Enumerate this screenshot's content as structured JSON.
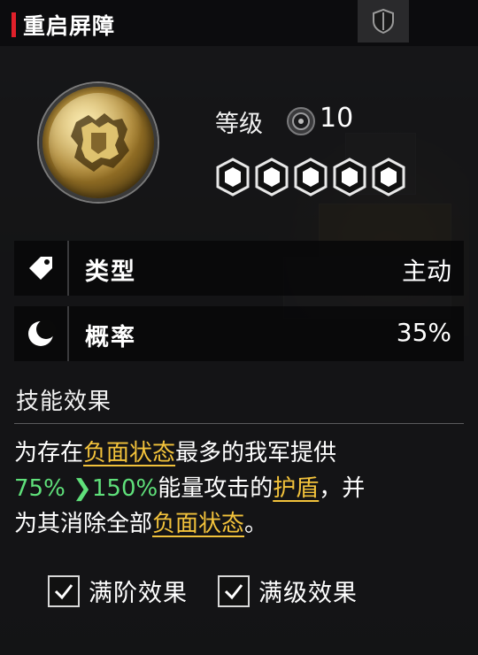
{
  "header": {
    "title": "重启屏障"
  },
  "skill": {
    "level_label": "等级",
    "level_value": "10",
    "star_count": 5,
    "emblem_icon": "golden-shield-emblem-icon"
  },
  "rows": [
    {
      "icon": "tag-icon",
      "key": "类型",
      "value": "主动"
    },
    {
      "icon": "moon-icon",
      "key": "概率",
      "value": "35%"
    }
  ],
  "effect": {
    "title": "技能效果",
    "line1_a": "为存在",
    "line1_kw": "负面状态",
    "line1_b": "最多的我军提供",
    "line2_from": "75%",
    "line2_to": "150%",
    "line2_a": "能量攻击的",
    "line2_kw": "护盾",
    "line2_b": "，并",
    "line3_a": "为其消除全部",
    "line3_kw": "负面状态",
    "line3_b": "。"
  },
  "checks": [
    {
      "label": "满阶效果",
      "checked": true
    },
    {
      "label": "满级效果",
      "checked": true
    }
  ],
  "colors": {
    "accent_red": "#e0202a",
    "keyword_yellow": "#f2c23b",
    "growth_green": "#5fe07a"
  }
}
